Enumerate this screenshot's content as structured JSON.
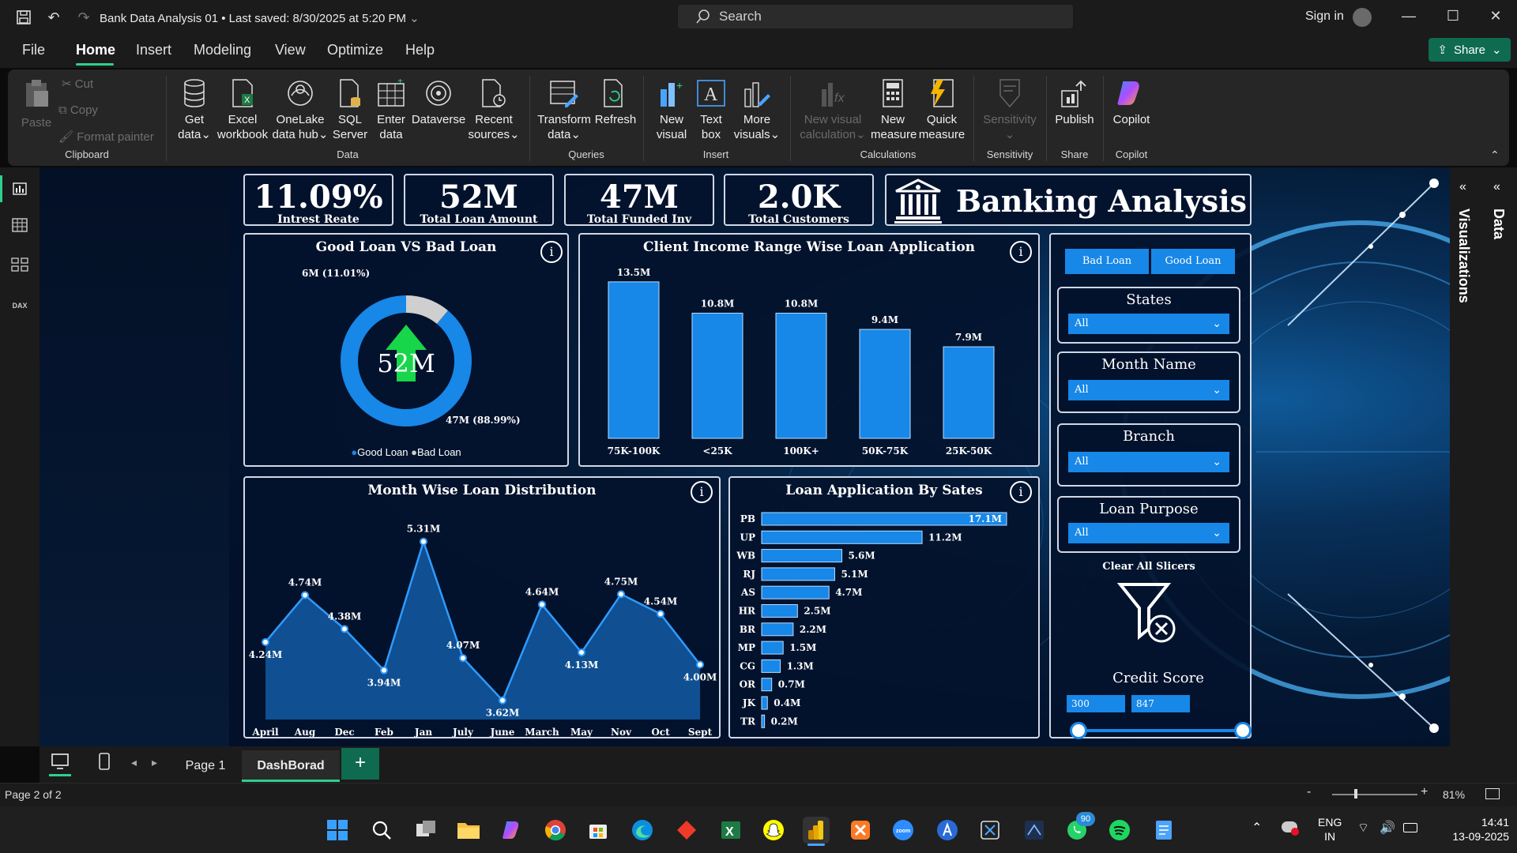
{
  "window": {
    "title": "Bank Data Analysis 01 • Last saved: 8/30/2025 at 5:20 PM",
    "search_placeholder": "Search",
    "sign_in": "Sign in"
  },
  "menu": {
    "items": [
      "File",
      "Home",
      "Insert",
      "Modeling",
      "View",
      "Optimize",
      "Help"
    ],
    "active": "Home",
    "share": "Share"
  },
  "ribbon": {
    "clipboard": {
      "paste": "Paste",
      "cut": "Cut",
      "copy": "Copy",
      "format_painter": "Format painter",
      "group": "Clipboard"
    },
    "data": {
      "get_data": [
        "Get",
        "data"
      ],
      "excel": [
        "Excel",
        "workbook"
      ],
      "onelake": [
        "OneLake",
        "data hub"
      ],
      "sql": [
        "SQL",
        "Server"
      ],
      "enter": [
        "Enter",
        "data"
      ],
      "dataverse": [
        "Dataverse",
        ""
      ],
      "recent": [
        "Recent",
        "sources"
      ],
      "group": "Data"
    },
    "queries": {
      "transform": [
        "Transform",
        "data"
      ],
      "refresh": [
        "Refresh",
        ""
      ],
      "group": "Queries"
    },
    "insert": {
      "new_visual": [
        "New",
        "visual"
      ],
      "text_box": [
        "Text",
        "box"
      ],
      "more_visuals": [
        "More",
        "visuals"
      ],
      "group": "Insert"
    },
    "calculations": {
      "new_visual_calc": [
        "New visual",
        "calculation"
      ],
      "new_measure": [
        "New",
        "measure"
      ],
      "quick_measure": [
        "Quick",
        "measure"
      ],
      "group": "Calculations"
    },
    "sensitivity": {
      "label": "Sensitivity",
      "group": "Sensitivity"
    },
    "share": {
      "publish": "Publish",
      "group": "Share"
    },
    "copilot": {
      "label": "Copilot",
      "group": "Copilot"
    }
  },
  "kpis": [
    {
      "value": "11.09%",
      "label": "Intrest Reate"
    },
    {
      "value": "52M",
      "label": "Total Loan Amount"
    },
    {
      "value": "47M",
      "label": "Total Funded Inv"
    },
    {
      "value": "2.0K",
      "label": "Total Customers"
    }
  ],
  "banner": {
    "title": "Banking Analysis"
  },
  "donut": {
    "title": "Good Loan VS Bad Loan",
    "center": "52M",
    "bad_label": "6M (11.01%)",
    "good_label": "47M (88.99%)",
    "legend": [
      "Good Loan",
      "Bad Loan"
    ]
  },
  "income_chart": {
    "title": "Client Income Range Wise Loan Application"
  },
  "month_chart": {
    "title": "Month Wise Loan Distribution"
  },
  "states_chart": {
    "title": "Loan Application By Sates"
  },
  "chart_data": [
    {
      "type": "bar",
      "title": "Client Income Range Wise Loan Application",
      "categories": [
        "75K-100K",
        "<25K",
        "100K+",
        "50K-75K",
        "25K-50K"
      ],
      "values": [
        13.5,
        10.8,
        10.8,
        9.4,
        7.9
      ],
      "labels": [
        "13.5M",
        "10.8M",
        "10.8M",
        "9.4M",
        "7.9M"
      ],
      "ylim": [
        0,
        14
      ],
      "color": "#1787e8"
    },
    {
      "type": "area",
      "title": "Month Wise Loan Distribution",
      "categories": [
        "April",
        "Aug",
        "Dec",
        "Feb",
        "Jan",
        "July",
        "June",
        "March",
        "May",
        "Nov",
        "Oct",
        "Sept"
      ],
      "values": [
        4.24,
        4.74,
        4.38,
        3.94,
        5.31,
        4.07,
        3.62,
        4.64,
        4.13,
        4.75,
        4.54,
        4.0
      ],
      "labels": [
        "4.24M",
        "4.74M",
        "4.38M",
        "3.94M",
        "5.31M",
        "4.07M",
        "3.62M",
        "4.64M",
        "4.13M",
        "4.75M",
        "4.54M",
        "4.00M"
      ],
      "ylim": [
        3.5,
        5.4
      ],
      "color": "#1787e8"
    },
    {
      "type": "bar",
      "orientation": "horizontal",
      "title": "Loan Application By Sates",
      "categories": [
        "PB",
        "UP",
        "WB",
        "RJ",
        "AS",
        "HR",
        "BR",
        "MP",
        "CG",
        "OR",
        "JK",
        "TR"
      ],
      "values": [
        17.1,
        11.2,
        5.6,
        5.1,
        4.7,
        2.5,
        2.2,
        1.5,
        1.3,
        0.7,
        0.4,
        0.2
      ],
      "labels": [
        "17.1M",
        "11.2M",
        "5.6M",
        "5.1M",
        "4.7M",
        "2.5M",
        "2.2M",
        "1.5M",
        "1.3M",
        "0.7M",
        "0.4M",
        "0.2M"
      ],
      "xlim": [
        0,
        17.1
      ],
      "color": "#1787e8"
    },
    {
      "type": "pie",
      "title": "Good Loan VS Bad Loan",
      "categories": [
        "Good Loan",
        "Bad Loan"
      ],
      "values": [
        88.99,
        11.01
      ],
      "colors": [
        "#1787e8",
        "#cfcfcf"
      ]
    }
  ],
  "slicers": {
    "loan_toggle": [
      "Bad Loan",
      "Good Loan"
    ],
    "states": {
      "title": "States",
      "value": "All"
    },
    "month": {
      "title": "Month Name",
      "value": "All"
    },
    "branch": {
      "title": "Branch",
      "value": "All"
    },
    "purpose": {
      "title": "Loan Purpose",
      "value": "All"
    },
    "clear": "Clear All Slicers",
    "credit": {
      "title": "Credit Score",
      "min": "300",
      "max": "847"
    }
  },
  "panes": {
    "visualizations": "Visualizations",
    "data": "Data"
  },
  "pages": {
    "tabs": [
      "Page 1",
      "DashBorad"
    ],
    "active": "DashBorad",
    "add": "+"
  },
  "status": {
    "page": "Page 2 of 2",
    "zoom": "81%"
  },
  "taskbar": {
    "lang1": "ENG",
    "lang2": "IN",
    "time": "14:41",
    "date": "13-09-2025",
    "whatsapp_badge": "90"
  },
  "colors": {
    "accent": "#2fd08c",
    "bar": "#1787e8",
    "green": "#0f6b4f"
  }
}
